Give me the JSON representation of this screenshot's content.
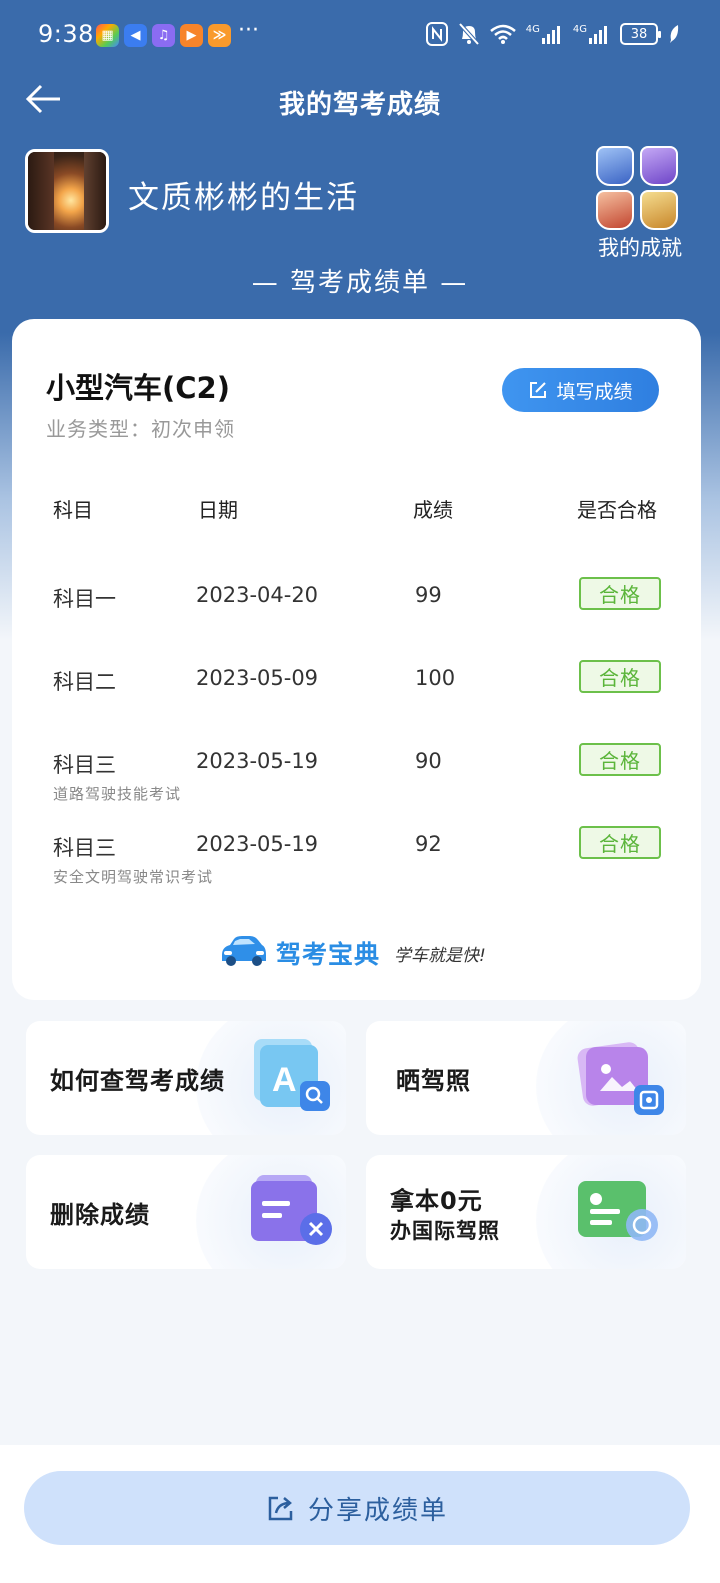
{
  "status_bar": {
    "time": "9:38",
    "more": "···",
    "signal_a": "4G",
    "signal_b": "4G",
    "battery": "38"
  },
  "header": {
    "title": "我的驾考成绩"
  },
  "profile": {
    "username": "文质彬彬的生活",
    "achievements_label": "我的成就"
  },
  "report_heading": "— 驾考成绩单 —",
  "card": {
    "vehicle": "小型汽车(C2)",
    "business_type": "业务类型：初次申领",
    "fill_button": "填写成绩",
    "columns": [
      "科目",
      "日期",
      "成绩",
      "是否合格"
    ],
    "rows": [
      {
        "subject": "科目一",
        "note": "",
        "date": "2023-04-20",
        "score": "99",
        "status": "合格"
      },
      {
        "subject": "科目二",
        "note": "",
        "date": "2023-05-09",
        "score": "100",
        "status": "合格"
      },
      {
        "subject": "科目三",
        "note": "道路驾驶技能考试",
        "date": "2023-05-19",
        "score": "90",
        "status": "合格"
      },
      {
        "subject": "科目三",
        "note": "安全文明驾驶常识考试",
        "date": "2023-05-19",
        "score": "92",
        "status": "合格"
      }
    ],
    "brand": {
      "name": "驾考宝典",
      "slogan": "学车就是快!"
    }
  },
  "tiles": [
    {
      "label": "如何查驾考成绩",
      "icon": "search-doc-icon"
    },
    {
      "label": "晒驾照",
      "icon": "photo-share-icon"
    },
    {
      "label": "删除成绩",
      "icon": "delete-doc-icon"
    },
    {
      "label_line1": "拿本0元",
      "label_line2": "办国际驾照",
      "icon": "license-card-icon"
    }
  ],
  "share_button": "分享成绩单",
  "colors": {
    "header_blue": "#3a6bab",
    "pass_green": "#5bb53a",
    "accent_blue": "#2f7fe0"
  }
}
